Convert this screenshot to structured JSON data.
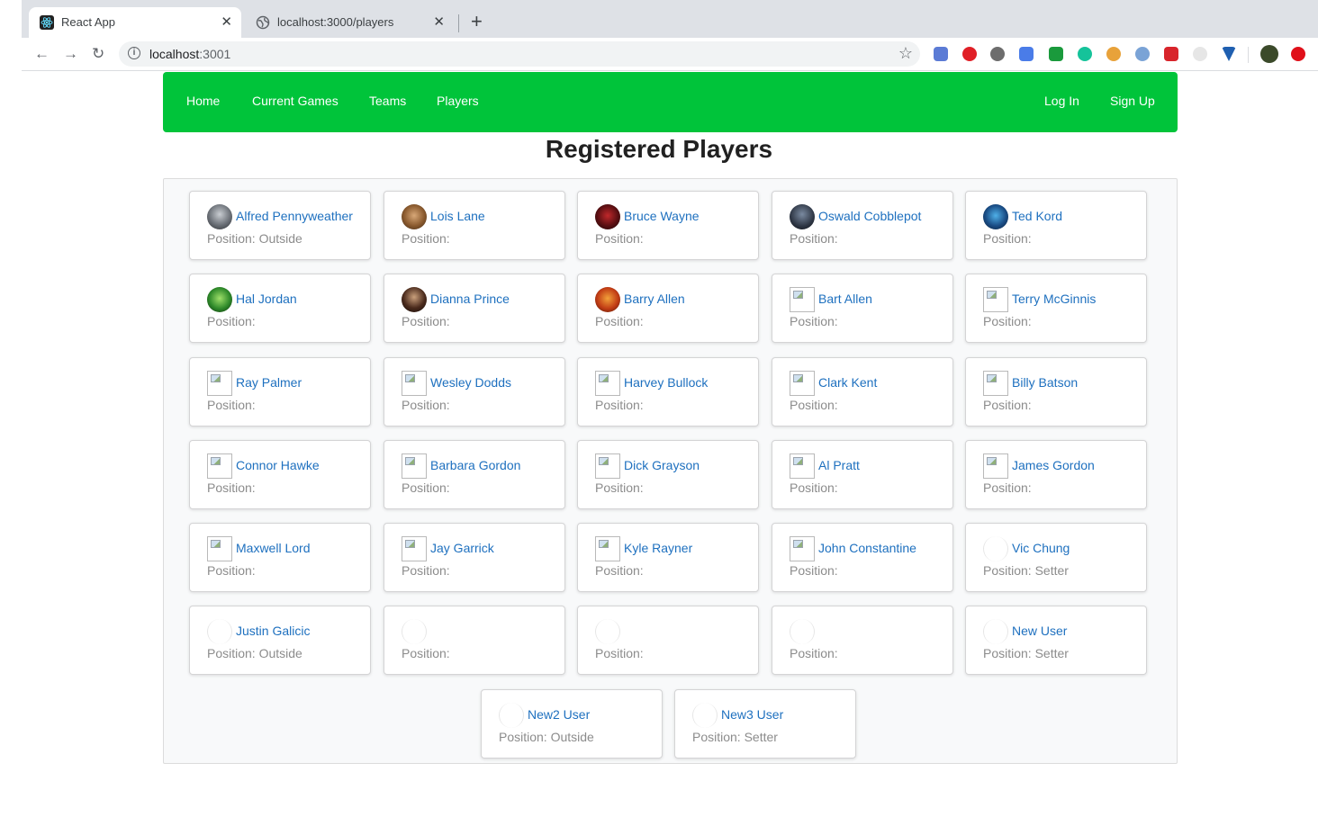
{
  "browser": {
    "tabs": [
      {
        "title": "React App",
        "active": true
      },
      {
        "title": "localhost:3000/players",
        "active": false
      }
    ],
    "url_host": "localhost",
    "url_port": ":3001"
  },
  "nav": {
    "links": [
      "Home",
      "Current Games",
      "Teams",
      "Players"
    ],
    "right_links": [
      "Log In",
      "Sign Up"
    ],
    "color": "#00c43a"
  },
  "page": {
    "title": "Registered Players",
    "position_label": "Position:"
  },
  "players": [
    {
      "name": "Alfred Pennyweather",
      "position": "Outside",
      "avatar": "photo"
    },
    {
      "name": "Lois Lane",
      "position": "",
      "avatar": "photo"
    },
    {
      "name": "Bruce Wayne",
      "position": "",
      "avatar": "photo"
    },
    {
      "name": "Oswald Cobblepot",
      "position": "",
      "avatar": "photo"
    },
    {
      "name": "Ted Kord",
      "position": "",
      "avatar": "photo"
    },
    {
      "name": "Hal Jordan",
      "position": "",
      "avatar": "photo"
    },
    {
      "name": "Dianna Prince",
      "position": "",
      "avatar": "photo"
    },
    {
      "name": "Barry Allen",
      "position": "",
      "avatar": "photo"
    },
    {
      "name": "Bart Allen",
      "position": "",
      "avatar": "broken"
    },
    {
      "name": "Terry McGinnis",
      "position": "",
      "avatar": "broken"
    },
    {
      "name": "Ray Palmer",
      "position": "",
      "avatar": "broken"
    },
    {
      "name": "Wesley Dodds",
      "position": "",
      "avatar": "broken"
    },
    {
      "name": "Harvey Bullock",
      "position": "",
      "avatar": "broken"
    },
    {
      "name": "Clark Kent",
      "position": "",
      "avatar": "broken"
    },
    {
      "name": "Billy Batson",
      "position": "",
      "avatar": "broken"
    },
    {
      "name": "Connor Hawke",
      "position": "",
      "avatar": "broken"
    },
    {
      "name": "Barbara Gordon",
      "position": "",
      "avatar": "broken"
    },
    {
      "name": "Dick Grayson",
      "position": "",
      "avatar": "broken"
    },
    {
      "name": "Al Pratt",
      "position": "",
      "avatar": "broken"
    },
    {
      "name": "James Gordon",
      "position": "",
      "avatar": "broken"
    },
    {
      "name": "Maxwell Lord",
      "position": "",
      "avatar": "broken"
    },
    {
      "name": "Jay Garrick",
      "position": "",
      "avatar": "broken"
    },
    {
      "name": "Kyle Rayner",
      "position": "",
      "avatar": "broken"
    },
    {
      "name": "John Constantine",
      "position": "",
      "avatar": "broken"
    },
    {
      "name": "Vic Chung",
      "position": "Setter",
      "avatar": "blank"
    },
    {
      "name": "Justin Galicic",
      "position": "Outside",
      "avatar": "blank"
    },
    {
      "name": "",
      "position": "",
      "avatar": "blank"
    },
    {
      "name": "",
      "position": "",
      "avatar": "blank"
    },
    {
      "name": "",
      "position": "",
      "avatar": "blank"
    },
    {
      "name": "New User",
      "position": "Setter",
      "avatar": "blank"
    },
    {
      "name": "New2 User",
      "position": "Outside",
      "avatar": "blank"
    },
    {
      "name": "New3 User",
      "position": "Setter",
      "avatar": "blank"
    }
  ]
}
